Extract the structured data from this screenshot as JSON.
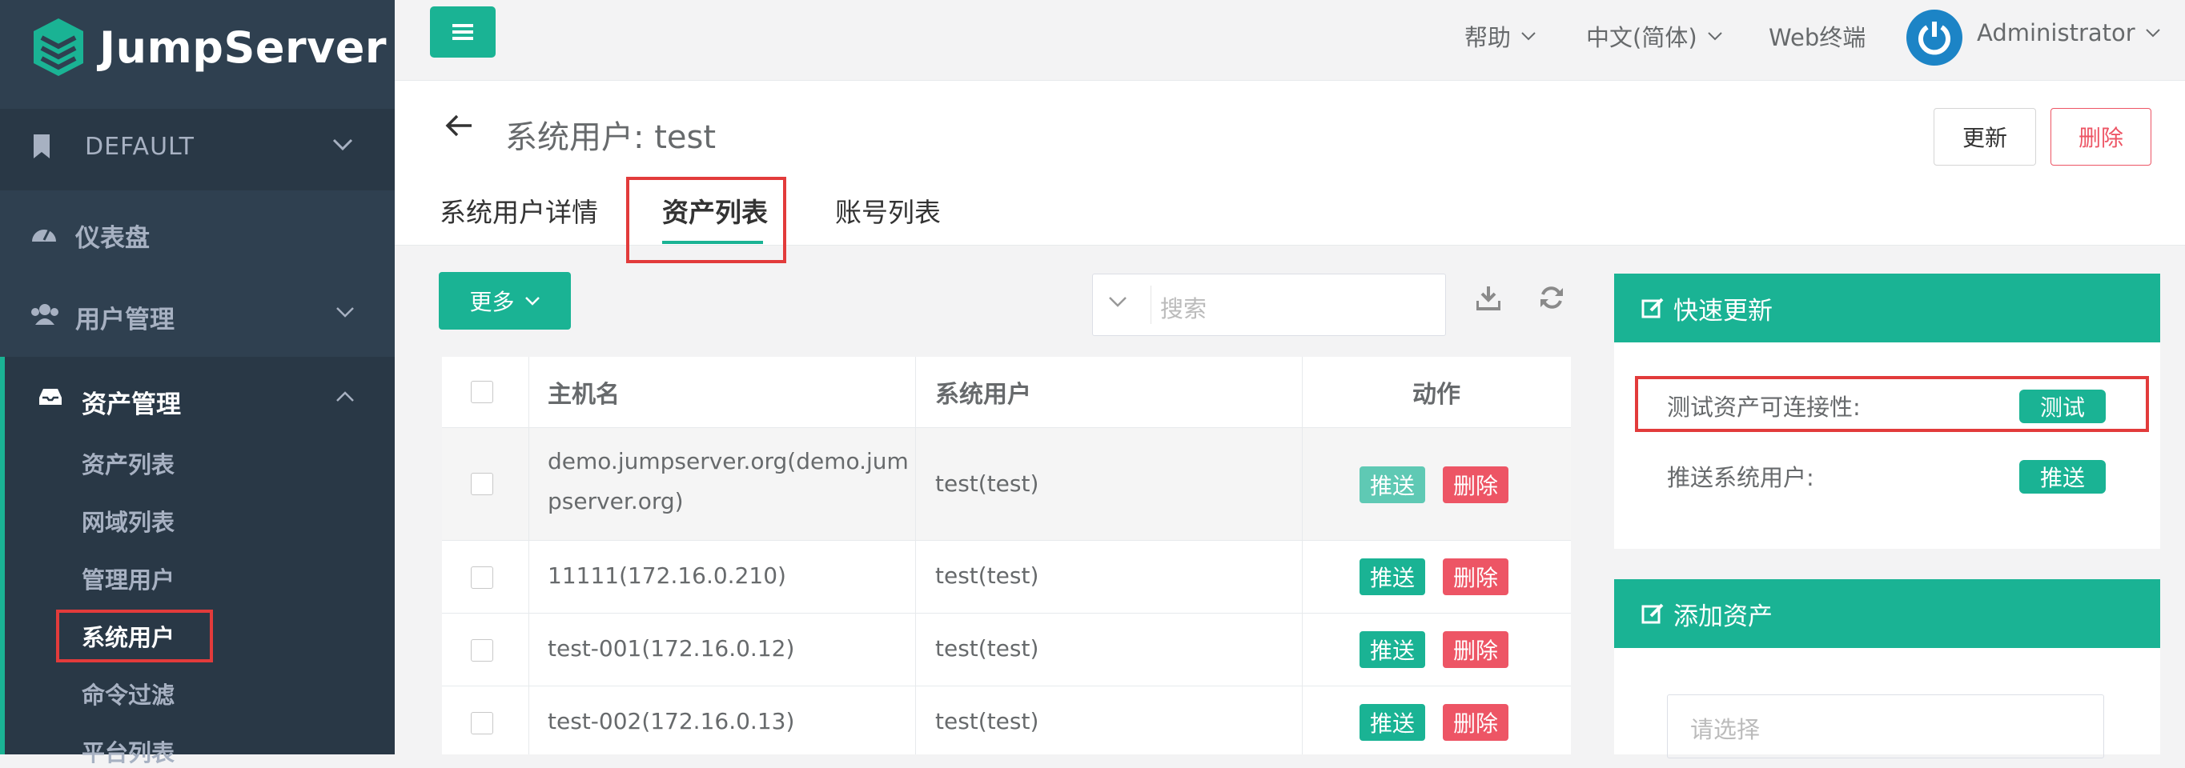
{
  "app": {
    "logo_text": "JumpServer"
  },
  "sidebar": {
    "org": "DEFAULT",
    "items": [
      {
        "label": "仪表盘"
      },
      {
        "label": "用户管理"
      },
      {
        "label": "资产管理"
      }
    ],
    "asset_sub": [
      {
        "label": "资产列表"
      },
      {
        "label": "网域列表"
      },
      {
        "label": "管理用户"
      },
      {
        "label": "系统用户"
      },
      {
        "label": "命令过滤"
      },
      {
        "label": "平台列表"
      }
    ]
  },
  "topbar": {
    "help": "帮助",
    "language": "中文(简体)",
    "web_terminal": "Web终端",
    "user": "Administrator"
  },
  "page": {
    "title": "系统用户: test",
    "update_label": "更新",
    "delete_label": "删除",
    "tabs": [
      {
        "label": "系统用户详情"
      },
      {
        "label": "资产列表"
      },
      {
        "label": "账号列表"
      }
    ]
  },
  "toolbar": {
    "more_label": "更多",
    "search_placeholder": "搜索"
  },
  "table": {
    "headers": [
      "主机名",
      "系统用户",
      "动作"
    ],
    "rows": [
      {
        "host_line1": "demo.jumpserver.org(demo.jum",
        "host_line2": "pserver.org)",
        "sysuser": "test(test)"
      },
      {
        "host": "11111(172.16.0.210)",
        "sysuser": "test(test)"
      },
      {
        "host": "test-001(172.16.0.12)",
        "sysuser": "test(test)"
      },
      {
        "host": "test-002(172.16.0.13)",
        "sysuser": "test(test)"
      }
    ],
    "push_label": "推送",
    "delete_label": "删除"
  },
  "quick_update": {
    "title": "快速更新",
    "test_label": "测试资产可连接性:",
    "test_button": "测试",
    "push_label": "推送系统用户:",
    "push_button": "推送"
  },
  "add_asset": {
    "title": "添加资产",
    "placeholder": "请选择"
  },
  "colors": {
    "primary": "#1ab394",
    "danger": "#ed5565",
    "sidebar_bg": "#2f4050",
    "highlight": "#e23b3b"
  }
}
